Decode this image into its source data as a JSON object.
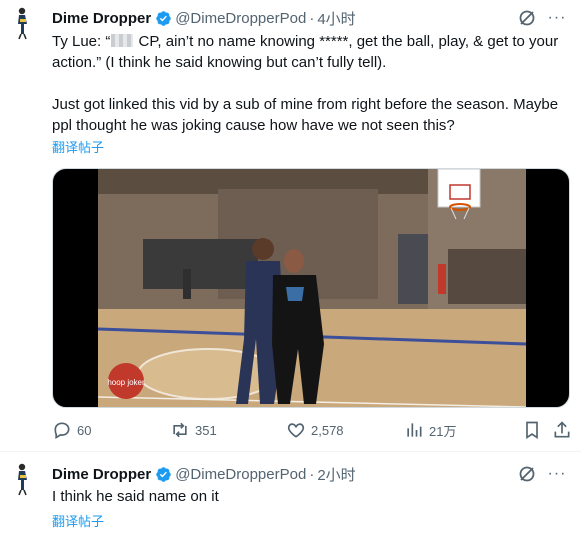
{
  "tweets": [
    {
      "author": {
        "name": "Dime Dropper",
        "handle": "@DimeDropperPod",
        "time": "4小时"
      },
      "text": {
        "line1_pre": "Ty Lue: “",
        "line1_post": " CP, ain’t no name knowing *****, get the ball, play, & get to your action.”  (I think he said knowing but can’t fully tell).",
        "para2": "Just got linked this vid by a sub of mine from right before the season. Maybe ppl thought he was joking cause how have we not seen this?"
      },
      "translate": "翻译帖子",
      "media": {
        "watermark": "hoop joker"
      },
      "stats": {
        "replies": "60",
        "reposts": "351",
        "likes": "2,578",
        "views": "21万"
      }
    },
    {
      "author": {
        "name": "Dime Dropper",
        "handle": "@DimeDropperPod",
        "time": "2小时"
      },
      "text": {
        "body": "I think he said name on it"
      },
      "translate": "翻译帖子"
    }
  ],
  "colors": {
    "accent": "#1d9bf0",
    "secondary_text": "#536471",
    "primary_text": "#0f1419"
  },
  "icons": [
    "avatar-figure",
    "verified-badge",
    "grok-icon",
    "more-icon",
    "reply-icon",
    "repost-icon",
    "like-icon",
    "views-icon",
    "bookmark-icon",
    "share-icon"
  ]
}
